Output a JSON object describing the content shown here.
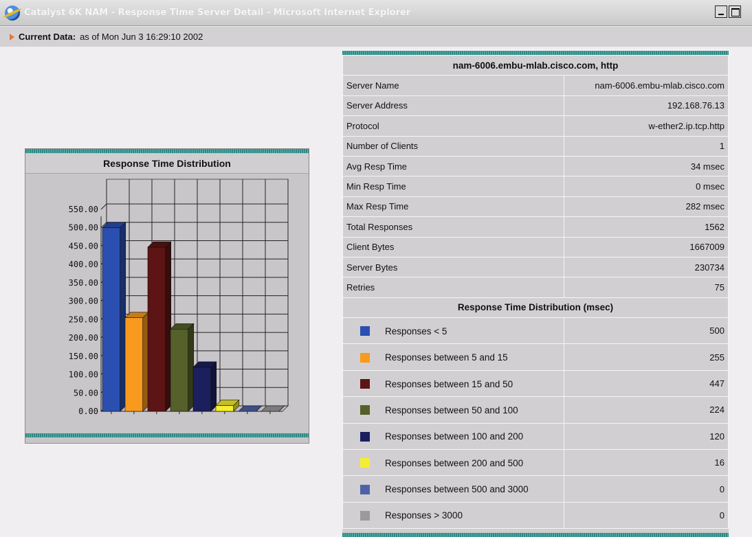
{
  "window": {
    "title": "Catalyst 6K NAM - Response Time Server Detail - Microsoft Internet Explorer",
    "icon": "internet-explorer-icon"
  },
  "current_data": {
    "label": "Current Data:",
    "value": "as of Mon Jun 3 16:29:10 2002"
  },
  "server_table": {
    "header": "nam-6006.embu-mlab.cisco.com, http",
    "rows": [
      {
        "label": "Server Name",
        "value": "nam-6006.embu-mlab.cisco.com"
      },
      {
        "label": "Server Address",
        "value": "192.168.76.13"
      },
      {
        "label": "Protocol",
        "value": "w-ether2.ip.tcp.http"
      },
      {
        "label": "Number of Clients",
        "value": "1"
      },
      {
        "label": "Avg Resp Time",
        "value": "34 msec"
      },
      {
        "label": "Min Resp Time",
        "value": "0 msec"
      },
      {
        "label": "Max Resp Time",
        "value": "282 msec"
      },
      {
        "label": "Total Responses",
        "value": "1562"
      },
      {
        "label": "Client Bytes",
        "value": "1667009"
      },
      {
        "label": "Server Bytes",
        "value": "230734"
      },
      {
        "label": "Retries",
        "value": "75"
      }
    ],
    "distribution_header": "Response Time Distribution (msec)",
    "distribution": [
      {
        "label": "Responses < 5",
        "value": "500",
        "color": "#2a4fb0"
      },
      {
        "label": "Responses between 5 and 15",
        "value": "255",
        "color": "#f79a1e"
      },
      {
        "label": "Responses between 15 and 50",
        "value": "447",
        "color": "#5c1414"
      },
      {
        "label": "Responses between 50 and 100",
        "value": "224",
        "color": "#55602a"
      },
      {
        "label": "Responses between 100 and 200",
        "value": "120",
        "color": "#1b1f5e"
      },
      {
        "label": "Responses between 200 and 500",
        "value": "16",
        "color": "#f4ee30"
      },
      {
        "label": "Responses between 500 and 3000",
        "value": "0",
        "color": "#4f62a8"
      },
      {
        "label": "Responses > 3000",
        "value": "0",
        "color": "#9a9a9a"
      }
    ]
  },
  "chart_data": {
    "type": "bar",
    "title": "Response Time Distribution",
    "categories": [
      "Responses < 5",
      "Responses between 5 and 15",
      "Responses between 15 and 50",
      "Responses between 50 and 100",
      "Responses between 100 and 200",
      "Responses between 200 and 500",
      "Responses between 500 and 3000",
      "Responses > 3000"
    ],
    "values": [
      500,
      255,
      447,
      224,
      120,
      16,
      0,
      0
    ],
    "colors": [
      "#2a4fb0",
      "#f79a1e",
      "#5c1414",
      "#55602a",
      "#1b1f5e",
      "#f4ee30",
      "#4f62a8",
      "#9a9a9a"
    ],
    "y_ticks": [
      "0.00",
      "50.00",
      "100.00",
      "150.00",
      "200.00",
      "250.00",
      "300.00",
      "350.00",
      "400.00",
      "450.00",
      "500.00",
      "550.00"
    ],
    "ylim": [
      0,
      550
    ],
    "grid": true
  }
}
